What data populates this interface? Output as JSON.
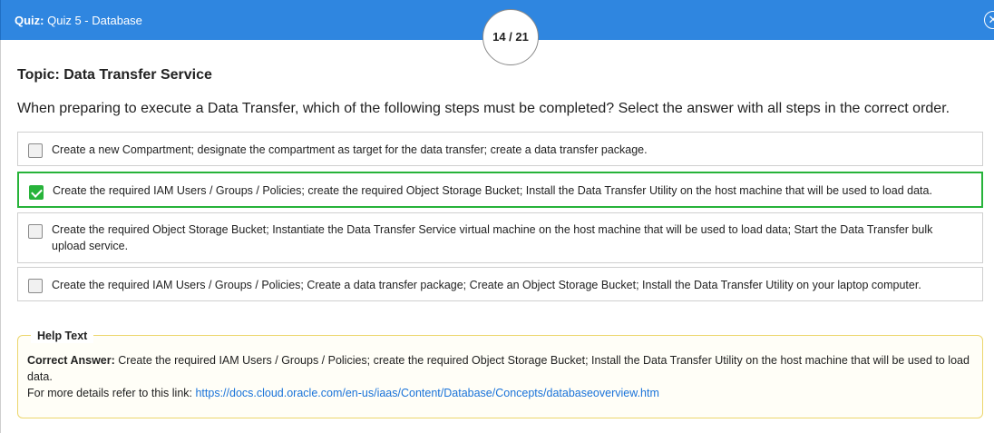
{
  "header": {
    "quiz_label": "Quiz:",
    "quiz_name": "Quiz 5 - Database",
    "counter": "14 / 21",
    "close_icon": "close-icon"
  },
  "topic": "Topic: Data Transfer Service",
  "question": "When preparing to execute a Data Transfer, which of the following steps must be completed?  Select the answer with all steps in the correct order.",
  "options": [
    {
      "text": "Create a new Compartment; designate the compartment as target for the data transfer; create a data transfer package.",
      "selected": false
    },
    {
      "text": "Create the required IAM Users / Groups / Policies; create the required Object Storage Bucket; Install the Data Transfer Utility on the host machine that will be used to load data.",
      "selected": true
    },
    {
      "text": "Create the required Object Storage Bucket; Instantiate the Data Transfer Service virtual machine on the host machine that will be used to load data; Start the Data Transfer bulk upload service.",
      "selected": false
    },
    {
      "text": "Create the required IAM Users / Groups / Policies; Create a data transfer package; Create an Object Storage Bucket; Install the Data Transfer Utility on your laptop computer.",
      "selected": false
    }
  ],
  "help": {
    "legend": "Help Text",
    "correct_label": "Correct Answer:",
    "correct_text": " Create the required IAM Users / Groups / Policies; create the required Object Storage Bucket; Install the Data Transfer Utility on the host machine that will be used to load data.",
    "details_prefix": "For more details refer to this link: ",
    "link": "https://docs.cloud.oracle.com/en-us/iaas/Content/Database/Concepts/databaseoverview.htm"
  },
  "colors": {
    "header": "#2f86e0",
    "selected": "#27b33a",
    "help_border": "#ecd66d",
    "link": "#1a73d9"
  }
}
